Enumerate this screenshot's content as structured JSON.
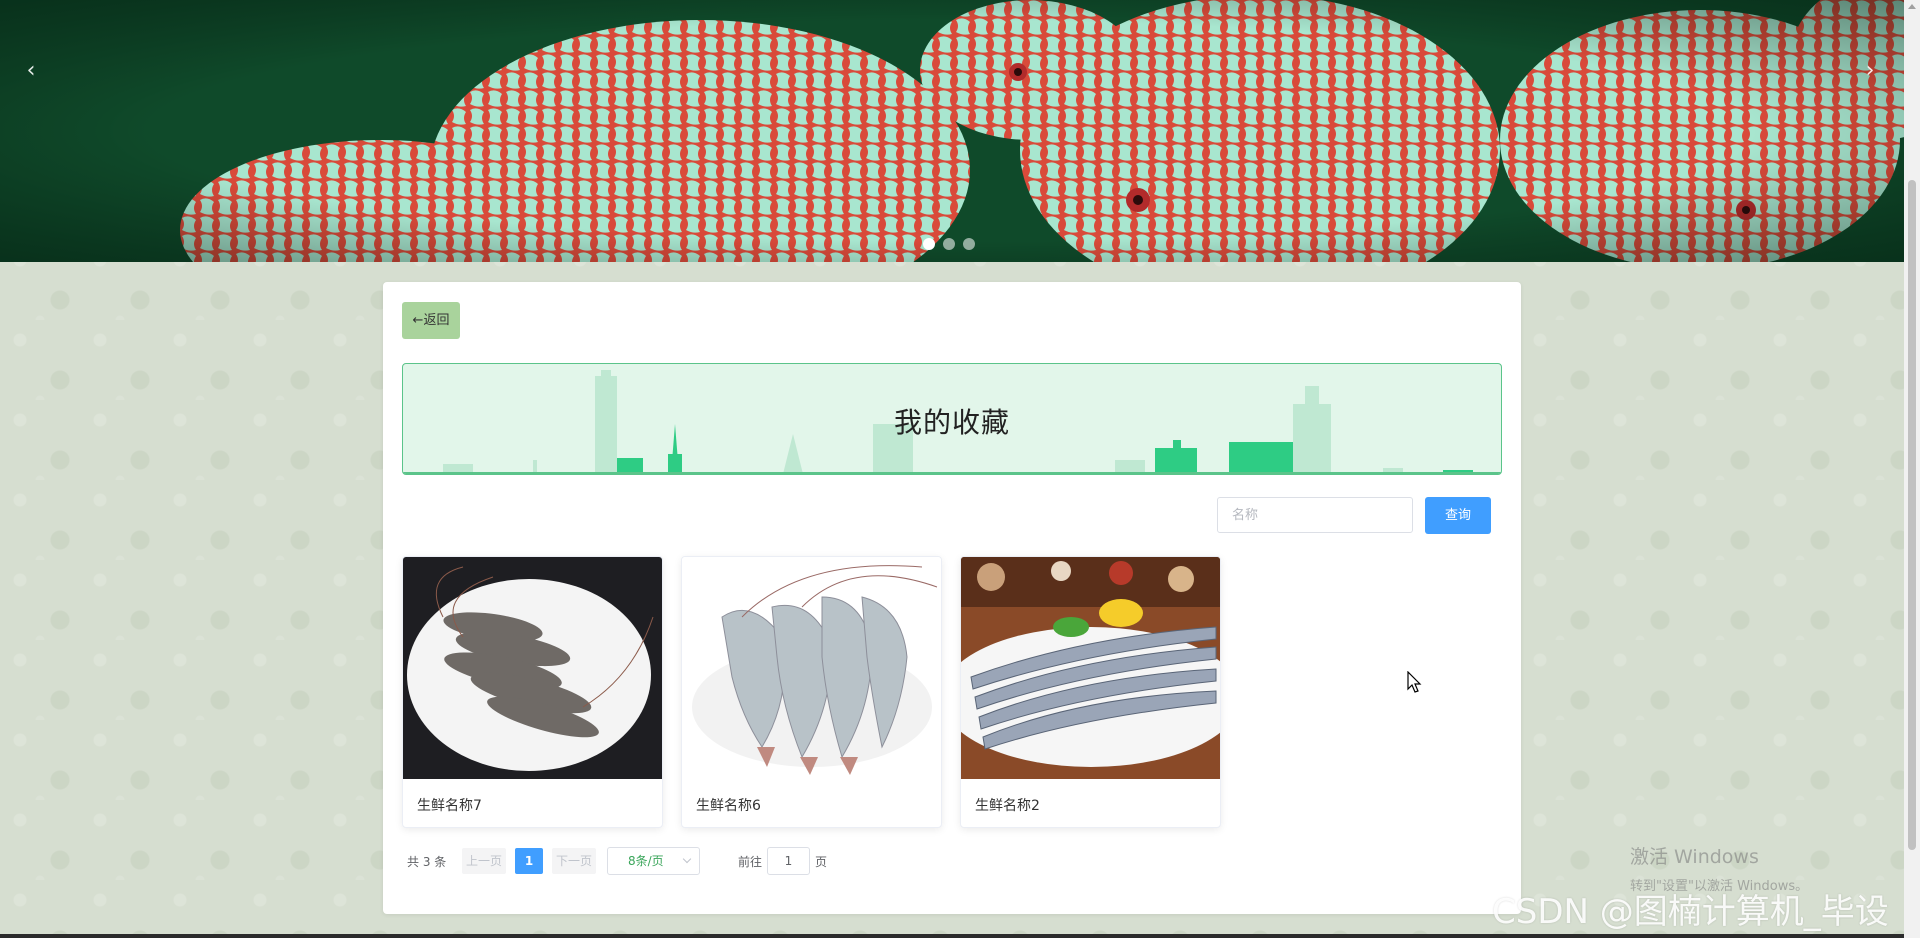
{
  "carousel": {
    "prev_label": "‹",
    "next_label": "›",
    "slide_count": 3,
    "active_index": 0
  },
  "page": {
    "back_label": "←返回",
    "title": "我的收藏"
  },
  "search": {
    "placeholder": "名称",
    "button_label": "查询"
  },
  "products": [
    {
      "name": "生鲜名称7",
      "image": "shrimp-on-plate"
    },
    {
      "name": "生鲜名称6",
      "image": "raw-prawns"
    },
    {
      "name": "生鲜名称2",
      "image": "saury-fish-plate"
    }
  ],
  "pagination": {
    "total_label": "共 3 条",
    "prev_label": "上一页",
    "current_page": "1",
    "next_label": "下一页",
    "page_size_label": "8条/页",
    "goto_label": "前往",
    "goto_value": "1",
    "page_suffix": "页"
  },
  "overlays": {
    "windows_line1": "激活 Windows",
    "windows_line2": "转到\"设置\"以激活 Windows。",
    "watermark": "CSDN @图楠计算机_毕设"
  },
  "colors": {
    "accent_blue": "#409eff",
    "back_button": "#a9d39c",
    "banner_bg": "#e2f6ea",
    "banner_border": "#5bc48a",
    "page_bg": "#d6ded0"
  }
}
